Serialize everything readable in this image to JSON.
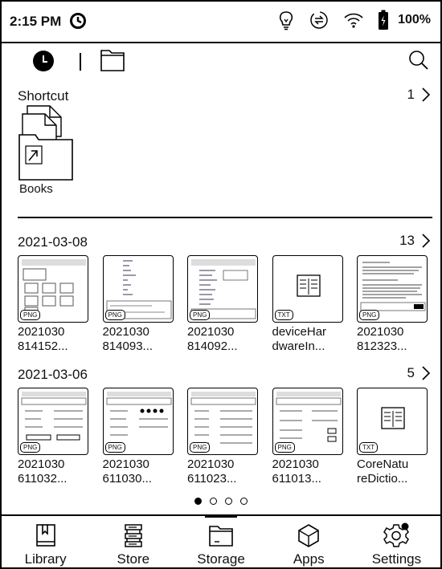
{
  "status": {
    "time": "2:15 PM",
    "battery": "100%"
  },
  "shortcut": {
    "title": "Shortcut",
    "count": "1",
    "items": [
      {
        "label": "Books"
      }
    ]
  },
  "groups": [
    {
      "date": "2021-03-08",
      "count": "13",
      "items": [
        {
          "line1": "2021030",
          "line2": "814152...",
          "type": "PNG"
        },
        {
          "line1": "2021030",
          "line2": "814093...",
          "type": "PNG"
        },
        {
          "line1": "2021030",
          "line2": "814092...",
          "type": "PNG"
        },
        {
          "line1": "deviceHar",
          "line2": "dwareIn...",
          "type": "TXT"
        },
        {
          "line1": "2021030",
          "line2": "812323...",
          "type": "PNG"
        }
      ]
    },
    {
      "date": "2021-03-06",
      "count": "5",
      "items": [
        {
          "line1": "2021030",
          "line2": "611032...",
          "type": "PNG"
        },
        {
          "line1": "2021030",
          "line2": "611030...",
          "type": "PNG"
        },
        {
          "line1": "2021030",
          "line2": "611023...",
          "type": "PNG"
        },
        {
          "line1": "2021030",
          "line2": "611013...",
          "type": "PNG"
        },
        {
          "line1": "CoreNatu",
          "line2": "reDictio...",
          "type": "TXT"
        }
      ]
    }
  ],
  "page_indicator": {
    "total": 4,
    "current": 1
  },
  "nav": {
    "items": [
      {
        "label": "Library",
        "icon": "library-icon"
      },
      {
        "label": "Store",
        "icon": "store-icon"
      },
      {
        "label": "Storage",
        "icon": "storage-icon",
        "active": true
      },
      {
        "label": "Apps",
        "icon": "apps-icon"
      },
      {
        "label": "Settings",
        "icon": "settings-icon"
      }
    ]
  }
}
